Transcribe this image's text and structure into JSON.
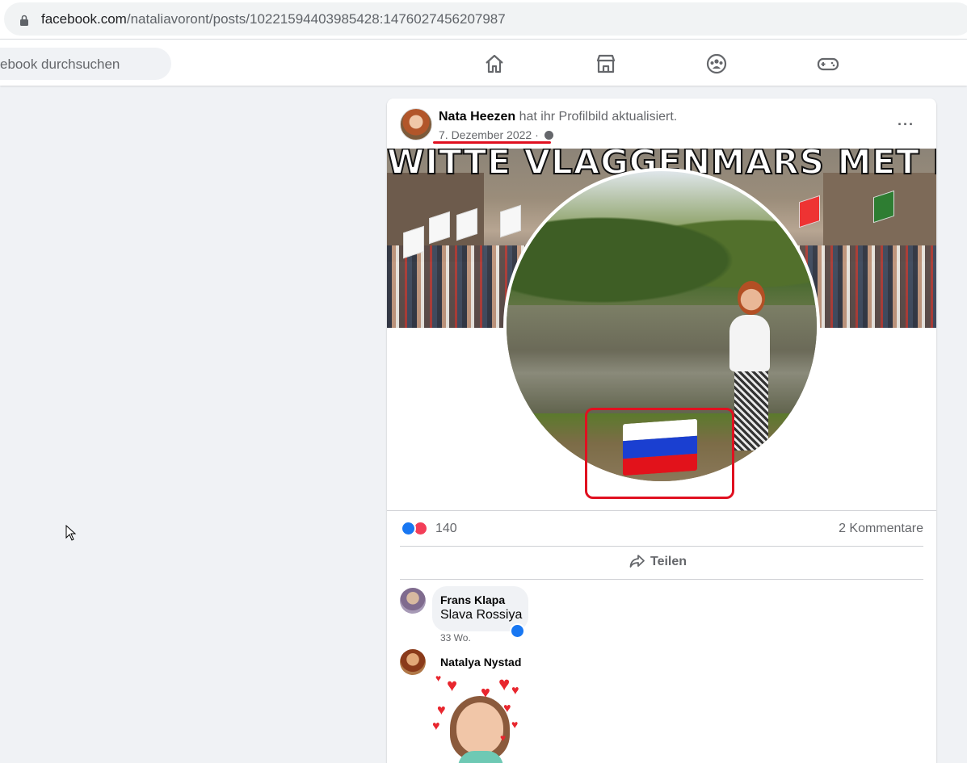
{
  "browser": {
    "url_host": "facebook.com",
    "url_path": "/nataliavoront/posts/10221594403985428:1476027456207987"
  },
  "nav": {
    "search_placeholder": "ebook durchsuchen",
    "icons": [
      "home-icon",
      "marketplace-icon",
      "groups-icon",
      "gaming-icon"
    ]
  },
  "post": {
    "author": "Nata Heezen",
    "action": "hat ihr Profilbild aktualisiert.",
    "date": "7. Dezember 2022",
    "date_separator": " · ",
    "more_label": "···",
    "cover_text": "WITTE VLAGGENMARS MET DRUMS",
    "reaction_count": "140",
    "comment_count": "2 Kommentare",
    "share_label": "Teilen"
  },
  "comments": [
    {
      "name": "Frans Klapa",
      "text": "Slava Rossiya",
      "time": "33 Wo."
    },
    {
      "name": "Natalya Nystad",
      "sticker": "hearts-avatar-sticker"
    }
  ],
  "colors": {
    "fb_blue": "#1877f2",
    "love_red": "#f33e58",
    "annotation_red": "#e01020",
    "bg": "#f0f2f5"
  }
}
